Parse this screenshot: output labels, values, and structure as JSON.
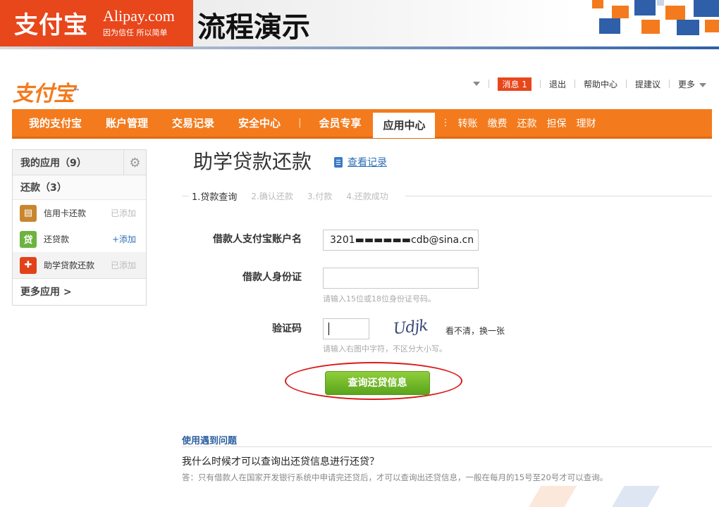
{
  "banner": {
    "logo_cn": "支付宝",
    "logo_en": "Alipay.com",
    "slogan": "因为信任 所以简单",
    "title": "流程演示"
  },
  "header": {
    "logo": "支付宝",
    "top_links": {
      "messages_label": "消息",
      "messages_count": "1",
      "logout": "退出",
      "help": "帮助中心",
      "feedback": "提建议",
      "more": "更多"
    }
  },
  "nav": {
    "items": [
      "我的支付宝",
      "账户管理",
      "交易记录",
      "安全中心",
      "会员专享"
    ],
    "active": "应用中心",
    "sub_items": [
      "转账",
      "缴费",
      "还款",
      "担保",
      "理财"
    ]
  },
  "sidebar": {
    "my_apps": "我的应用（9）",
    "repay_group": "还款（3）",
    "items": [
      {
        "label": "信用卡还款",
        "status": "已添加",
        "icon": "credit-card-icon",
        "color": "#c8862e"
      },
      {
        "label": "还贷款",
        "status": "+添加",
        "icon": "loan-icon",
        "color": "#6db33f"
      },
      {
        "label": "助学贷款还款",
        "status": "已添加",
        "icon": "student-loan-icon",
        "color": "#e2421a"
      }
    ],
    "more_apps": "更多应用 >"
  },
  "main": {
    "title": "助学贷款还款",
    "view_record": "查看记录",
    "steps": [
      "1.贷款查询",
      "2.确认还款",
      "3.付款",
      "4.还款成功"
    ],
    "form": {
      "account_label": "借款人支付宝账户名",
      "account_value": "3201▬▬▬▬▬▬cdb@sina.cn",
      "id_label": "借款人身份证",
      "id_hint": "请输入15位或18位身份证号码。",
      "captcha_label": "验证码",
      "captcha_text": "Udjk",
      "captcha_change": "看不清，换一张",
      "captcha_hint": "请输入右图中字符，不区分大小写。",
      "submit": "查询还贷信息"
    },
    "faq": {
      "title": "使用遇到问题",
      "question": "我什么时候才可以查询出还贷信息进行还贷？",
      "answer": "答：只有借款人在国家开发银行系统中申请完还贷后，才可以查询出还贷信息，一般在每月的15号至20号才可以查询。"
    }
  },
  "colors": {
    "brand_orange": "#f37b1d",
    "brand_blue": "#1a6fb8",
    "banner_red": "#e8461b",
    "submit_green": "#6cb52a",
    "highlight_red": "#d91a1a"
  }
}
